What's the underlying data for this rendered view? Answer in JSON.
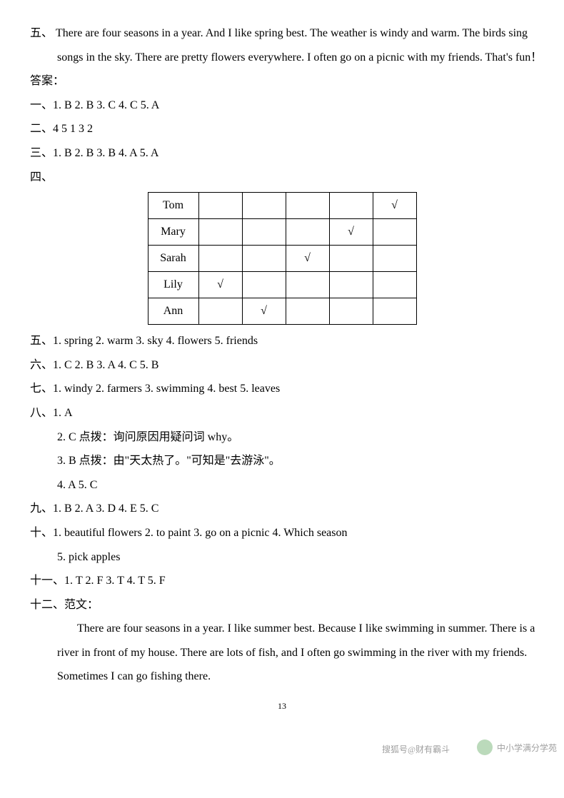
{
  "section_five_passage": {
    "label": "五、",
    "line_all": "There are four seasons in a year. And I like spring best. The weather is windy and warm. The birds sing songs in the sky. There are pretty flowers everywhere. I often go on a picnic with my friends. That's fun！"
  },
  "answers_label": "答案：",
  "ans1": "一、1. B    2. B    3. C    4. C    5. A",
  "ans2": "二、4   5    1   3   2",
  "ans3": "三、1. B    2. B    3. B    4. A    5. A",
  "ans4_label": "四、",
  "table": {
    "rows": [
      {
        "name": "Tom",
        "cells": [
          "",
          "",
          "",
          "",
          "√"
        ]
      },
      {
        "name": "Mary",
        "cells": [
          "",
          "",
          "",
          "√",
          ""
        ]
      },
      {
        "name": "Sarah",
        "cells": [
          "",
          "",
          "√",
          "",
          ""
        ]
      },
      {
        "name": "Lily",
        "cells": [
          "√",
          "",
          "",
          "",
          ""
        ]
      },
      {
        "name": "Ann",
        "cells": [
          "",
          "√",
          "",
          "",
          ""
        ]
      }
    ]
  },
  "ans5": "五、1. spring    2. warm    3. sky    4. flowers    5. friends",
  "ans6": "六、1. C    2. B    3. A    4. C    5. B",
  "ans7": "七、1. windy    2. farmers    3. swimming    4. best    5. leaves",
  "ans8": {
    "line1": "八、1. A",
    "line2": "2. C    点拨：询问原因用疑问词 why。",
    "line3": "3. B    点拨：由\"天太热了。\"可知是\"去游泳\"。",
    "line4": "4. A    5. C"
  },
  "ans9": "九、1. B    2. A    3. D    4. E    5. C",
  "ans10": {
    "line1": "十、1. beautiful flowers    2. to paint    3. go on a picnic    4. Which season",
    "line2": "5. pick apples"
  },
  "ans11": "十一、1. T    2. F    3. T    4. T    5. F",
  "ans12": {
    "label": "十二、范文：",
    "essay": "There are four seasons in a year. I like summer best. Because I like swimming in summer. There is a river in front of my house. There are lots of fish, and I often go swimming in the river with my friends. Sometimes I can go fishing there."
  },
  "pagenum": "13",
  "watermark_left": "搜狐号@财有霸斗",
  "watermark_right": "中小学满分学苑"
}
